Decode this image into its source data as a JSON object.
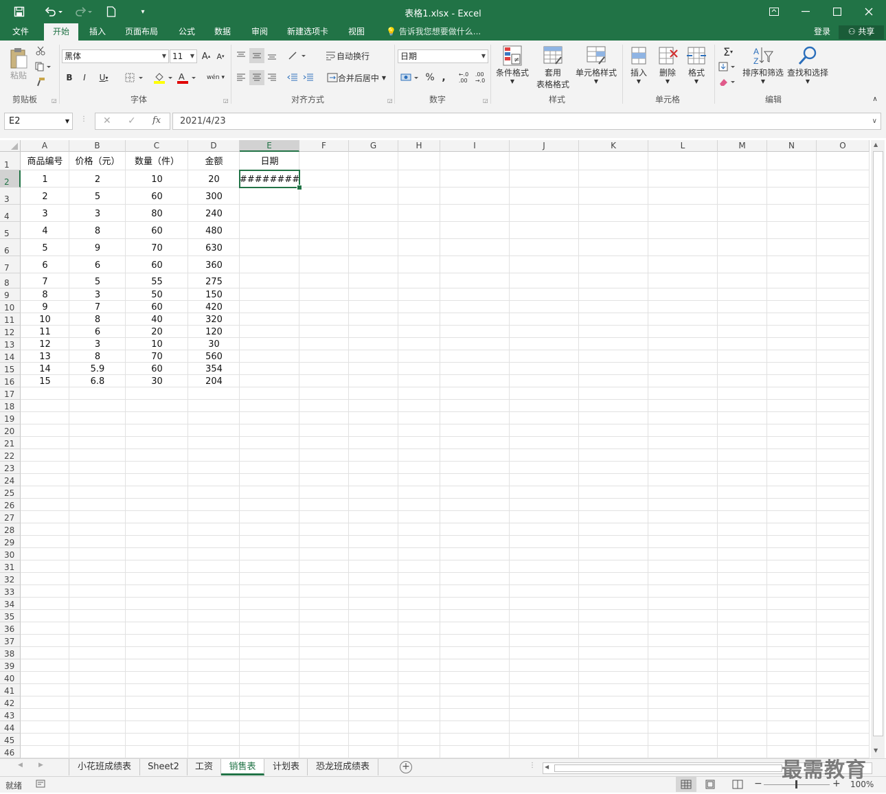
{
  "window": {
    "title": "表格1.xlsx - Excel"
  },
  "tabs": [
    "文件",
    "开始",
    "插入",
    "页面布局",
    "公式",
    "数据",
    "审阅",
    "新建选项卡",
    "视图"
  ],
  "active_tab": "开始",
  "tell_me": "告诉我您想要做什么...",
  "login": "登录",
  "share": "共享",
  "ribbon": {
    "paste": "粘贴",
    "font_name": "黑体",
    "font_size": "11",
    "wrap": "自动换行",
    "merge": "合并后居中",
    "number_format": "日期",
    "cond_format": "条件格式",
    "table_format_1": "套用",
    "table_format_2": "表格格式",
    "cell_style": "单元格样式",
    "insert": "插入",
    "delete": "删除",
    "format": "格式",
    "sort_filter": "排序和筛选",
    "find_select": "查找和选择",
    "groups": {
      "clipboard": "剪贴板",
      "font": "字体",
      "alignment": "对齐方式",
      "number": "数字",
      "styles": "样式",
      "cells": "单元格",
      "editing": "编辑"
    }
  },
  "formula_bar": {
    "name_box": "E2",
    "value": "2021/4/23"
  },
  "columns": [
    "A",
    "B",
    "C",
    "D",
    "E",
    "F",
    "G",
    "H",
    "I",
    "J",
    "K",
    "L",
    "M",
    "N",
    "O"
  ],
  "headers": [
    "商品编号",
    "价格（元）",
    "数量（件）",
    "金额",
    "日期"
  ],
  "rows": [
    [
      "1",
      "2",
      "10",
      "20",
      "##########"
    ],
    [
      "2",
      "5",
      "60",
      "300",
      ""
    ],
    [
      "3",
      "3",
      "80",
      "240",
      ""
    ],
    [
      "4",
      "8",
      "60",
      "480",
      ""
    ],
    [
      "5",
      "9",
      "70",
      "630",
      ""
    ],
    [
      "6",
      "6",
      "60",
      "360",
      ""
    ],
    [
      "7",
      "5",
      "55",
      "275",
      ""
    ],
    [
      "8",
      "3",
      "50",
      "150",
      ""
    ],
    [
      "9",
      "7",
      "60",
      "420",
      ""
    ],
    [
      "10",
      "8",
      "40",
      "320",
      ""
    ],
    [
      "11",
      "6",
      "20",
      "120",
      ""
    ],
    [
      "12",
      "3",
      "10",
      "30",
      ""
    ],
    [
      "13",
      "8",
      "70",
      "560",
      ""
    ],
    [
      "14",
      "5.9",
      "60",
      "354",
      ""
    ],
    [
      "15",
      "6.8",
      "30",
      "204",
      ""
    ]
  ],
  "row_numbers": [
    "1",
    "2",
    "3",
    "4",
    "5",
    "6",
    "7",
    "8",
    "9",
    "10",
    "11",
    "12",
    "13",
    "14",
    "15",
    "16",
    "17",
    "18",
    "19",
    "20",
    "21",
    "22",
    "23",
    "24",
    "25",
    "26",
    "27",
    "28",
    "29",
    "30",
    "31",
    "32",
    "33",
    "34",
    "35",
    "36",
    "37",
    "38",
    "39",
    "40",
    "41",
    "42",
    "43",
    "44",
    "45",
    "46"
  ],
  "sheets": [
    "小花班成绩表",
    "Sheet2",
    "工资",
    "销售表",
    "计划表",
    "恐龙班成绩表"
  ],
  "active_sheet": "销售表",
  "status": {
    "ready": "就绪",
    "zoom": "100%"
  },
  "watermark": "最需教育",
  "colors": {
    "accent": "#217346",
    "ribbon_bg": "#f3f3f3"
  }
}
